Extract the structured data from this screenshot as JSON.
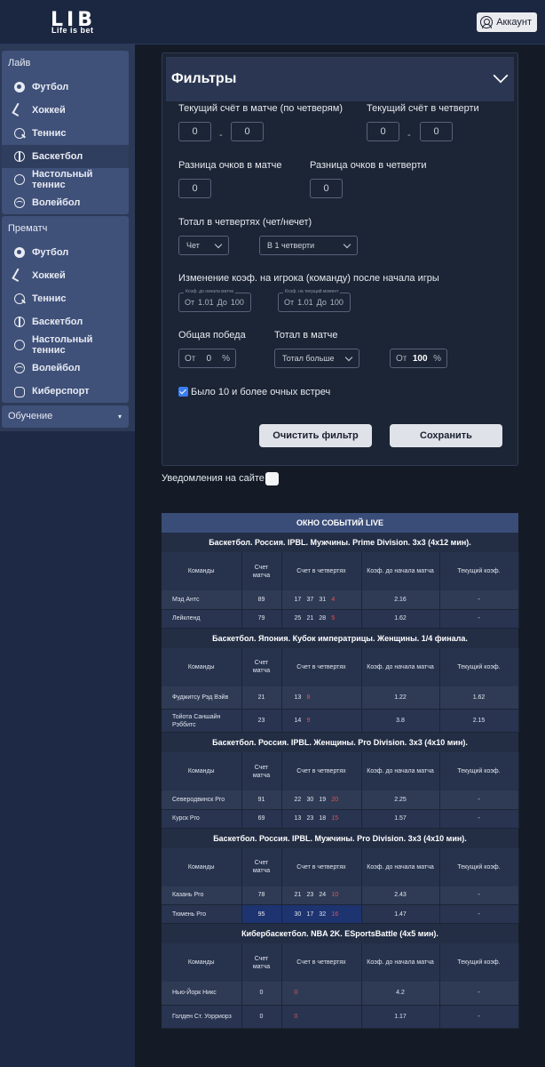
{
  "header": {
    "logo_main": "LIB",
    "logo_small": "Life is bet",
    "account_label": "Аккаунт"
  },
  "sidebar": {
    "live": {
      "title": "Лайв",
      "items": [
        {
          "label": "Футбол",
          "icon": "football-icon"
        },
        {
          "label": "Хоккей",
          "icon": "hockey-icon"
        },
        {
          "label": "Теннис",
          "icon": "tennis-icon"
        },
        {
          "label": "Баскетбол",
          "icon": "basketball-icon",
          "active": true
        },
        {
          "label": "Настольный теннис",
          "icon": "table-tennis-icon"
        },
        {
          "label": "Волейбол",
          "icon": "volleyball-icon"
        }
      ]
    },
    "prematch": {
      "title": "Прематч",
      "items": [
        {
          "label": "Футбол",
          "icon": "football-icon"
        },
        {
          "label": "Хоккей",
          "icon": "hockey-icon"
        },
        {
          "label": "Теннис",
          "icon": "tennis-icon"
        },
        {
          "label": "Баскетбол",
          "icon": "basketball-icon"
        },
        {
          "label": "Настольный теннис",
          "icon": "table-tennis-icon"
        },
        {
          "label": "Волейбол",
          "icon": "volleyball-icon"
        },
        {
          "label": "Киберспорт",
          "icon": "esports-icon"
        }
      ]
    },
    "learning": {
      "label": "Обучение",
      "caret": "▾"
    }
  },
  "filters": {
    "title": "Фильтры",
    "score_by_quarters_label": "Текущий счёт в матче (по четверям)",
    "score_by_quarters": [
      "0",
      "0"
    ],
    "score_in_quarter_label": "Текущий счёт в четверти",
    "score_in_quarter": [
      "0",
      "0"
    ],
    "dash": "-",
    "diff_match_label": "Разница очков в матче",
    "diff_match": "0",
    "diff_quarter_label": "Разница очков в четверти",
    "diff_quarter": "0",
    "total_quarters_label": "Тотал в четвертях (чет/нечет)",
    "parity_select": "Чет",
    "quarter_select": "В 1 четверти",
    "odds_change_label": "Изменение коэф. на игрока (команду) после начала игры",
    "odds_before_caption": "Коэф. до начала матча",
    "odds_current_caption": "Коэф. на текущий момент",
    "odds_before": {
      "from_label": "От",
      "from": "1.01",
      "to_label": "До",
      "to": "100"
    },
    "odds_current": {
      "from_label": "От",
      "from": "1.01",
      "to_label": "До",
      "to": "100"
    },
    "total_win_label": "Общая победа",
    "total_win": {
      "prefix": "От",
      "value": "0",
      "suffix": "%"
    },
    "total_match_label": "Тотал в матче",
    "total_select": "Тотал больше",
    "total_pct": {
      "prefix": "От",
      "value": "100",
      "suffix": "%"
    },
    "checkbox_label": "Было 10 и более очных встреч",
    "checkbox_checked": true,
    "clear_button": "Очистить фильтр",
    "save_button": "Сохранить"
  },
  "notifications": {
    "label": "Уведомления на сайте"
  },
  "events": {
    "title": "ОКНО СОБЫТИЙ LIVE",
    "columns": [
      "Команды",
      "Счет матча",
      "Счет в четвертях",
      "Коэф. до начала матча",
      "Текущий коэф."
    ],
    "leagues": [
      {
        "name": "Баскетбол. Россия. IPBL. Мужчины. Prime Division. 3x3 (4x12 мин).",
        "rows": [
          {
            "team": "Мэд Антс",
            "score": "89",
            "quarters": [
              "17",
              "37",
              "31",
              "4"
            ],
            "odds_before": "2.16",
            "odds_now": "-"
          },
          {
            "team": "Лейкленд",
            "score": "79",
            "quarters": [
              "25",
              "21",
              "28",
              "5"
            ],
            "odds_before": "1.62",
            "odds_now": "-"
          }
        ]
      },
      {
        "name": "Баскетбол. Япония. Кубок императрицы. Женщины. 1/4 финала.",
        "rows": [
          {
            "team": "Фуджитсу Рэд Вэйв",
            "score": "21",
            "quarters": [
              "13",
              "8"
            ],
            "odds_before": "1.22",
            "odds_now": "1.62"
          },
          {
            "team": "Тойота Саншайн Рэббитс",
            "score": "23",
            "quarters": [
              "14",
              "9"
            ],
            "odds_before": "3.8",
            "odds_now": "2.15"
          }
        ]
      },
      {
        "name": "Баскетбол. Россия. IPBL. Женщины. Pro Division. 3x3 (4x10 мин).",
        "rows": [
          {
            "team": "Северодвинск Pro",
            "score": "91",
            "quarters": [
              "22",
              "30",
              "19",
              "20"
            ],
            "odds_before": "2.25",
            "odds_now": "-"
          },
          {
            "team": "Курск Pro",
            "score": "69",
            "quarters": [
              "13",
              "23",
              "18",
              "15"
            ],
            "odds_before": "1.57",
            "odds_now": "-"
          }
        ]
      },
      {
        "name": "Баскетбол. Россия. IPBL. Мужчины. Pro Division. 3x3 (4x10 мин).",
        "rows": [
          {
            "team": "Казань Pro",
            "score": "78",
            "quarters": [
              "21",
              "23",
              "24",
              "10"
            ],
            "odds_before": "2.43",
            "odds_now": "-"
          },
          {
            "team": "Тюмень Pro",
            "score": "95",
            "quarters": [
              "30",
              "17",
              "32",
              "16"
            ],
            "odds_before": "1.47",
            "odds_now": "-"
          }
        ]
      },
      {
        "name": "Кибербаскетбол. NBA 2K. ESportsBattle (4x5 мин).",
        "rows": [
          {
            "team": "Нью-Йорк Никс",
            "score": "0",
            "quarters": [
              "0"
            ],
            "odds_before": "4.2",
            "odds_now": "-"
          },
          {
            "team": "Голден Ст. Уорриорз",
            "score": "0",
            "quarters": [
              "0"
            ],
            "odds_before": "1.17",
            "odds_now": "-"
          }
        ]
      }
    ]
  },
  "colors": {
    "topbar": "#1b2740",
    "sidebar_panel": "#3f5079",
    "accent_red": "#e05454",
    "checkbox_blue": "#3b7df0",
    "highlight": "#1e3471"
  }
}
